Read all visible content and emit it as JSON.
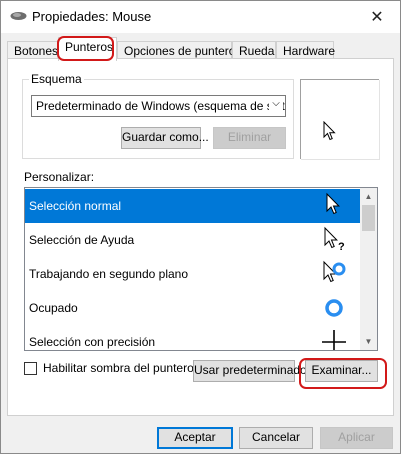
{
  "window": {
    "title": "Propiedades: Mouse",
    "close_glyph": "✕"
  },
  "tabs": [
    {
      "label": "Botones"
    },
    {
      "label": "Punteros"
    },
    {
      "label": "Opciones de puntero"
    },
    {
      "label": "Rueda"
    },
    {
      "label": "Hardware"
    }
  ],
  "scheme": {
    "group_label": "Esquema",
    "selected_value": "Predeterminado de Windows (esquema de siste",
    "save_as_label": "Guardar como...",
    "delete_label": "Eliminar"
  },
  "customize": {
    "label": "Personalizar:",
    "items": [
      {
        "label": "Selección normal",
        "icon": "arrow-cursor-icon",
        "selected": true
      },
      {
        "label": "Selección de Ayuda",
        "icon": "help-cursor-icon",
        "selected": false
      },
      {
        "label": "Trabajando en segundo plano",
        "icon": "working-background-cursor-icon",
        "selected": false
      },
      {
        "label": "Ocupado",
        "icon": "busy-ring-cursor-icon",
        "selected": false
      },
      {
        "label": "Selección con precisión",
        "icon": "crosshair-cursor-icon",
        "selected": false
      }
    ]
  },
  "shadow": {
    "label": "Habilitar sombra del puntero",
    "checked": false
  },
  "buttons": {
    "use_default": "Usar predeterminado",
    "browse": "Examinar..."
  },
  "footer": {
    "accept": "Aceptar",
    "cancel": "Cancelar",
    "apply": "Aplicar"
  },
  "colors": {
    "selection": "#0078d7",
    "highlight_ring": "#d21919",
    "busy_ring": "#2a8ef0"
  }
}
